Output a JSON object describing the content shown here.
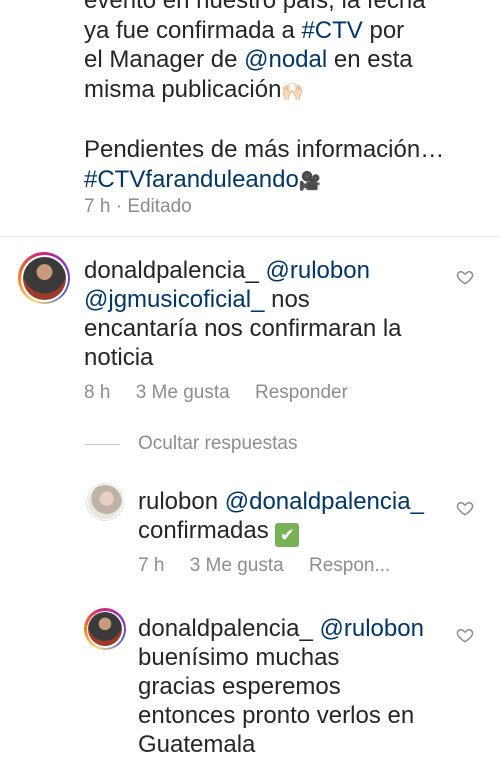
{
  "post_caption": {
    "line0": "evento en nuestro país, la fecha",
    "line1_pre": "ya fue confirmada a ",
    "line1_tag": "#CTV",
    "line1_post": " por",
    "line2_pre": "el Manager de ",
    "line2_tag": "@nodal",
    "line2_post": " en esta",
    "line3": "misma publicación",
    "line3_emoji": "🙌🏻",
    "line4": " Pendientes de más información…",
    "line5_tag": "#CTVfaranduleando",
    "line5_emoji": "🎥",
    "meta_time": "7 h",
    "meta_sep": " · ",
    "meta_edited": "Editado"
  },
  "comments": [
    {
      "username": "donaldpalencia_",
      "mention1": "@rulobon",
      "mention2": "@jgmusicoficial_",
      "text_after": " nos",
      "text_line3": "encantaría nos confirmaran la",
      "text_line4": "noticia",
      "time": "8 h",
      "likes": "3 Me gusta",
      "reply": "Responder",
      "avatar_icon": "profile-photo"
    }
  ],
  "hide_replies_label": "Ocultar respuestas",
  "replies": [
    {
      "username": "rulobon",
      "mention": "@donaldpalencia_",
      "text": "confirmadas",
      "emoji": "✔",
      "time": "7 h",
      "likes": "3 Me gusta",
      "reply": "Respon..."
    },
    {
      "username": "donaldpalencia_",
      "mention": "@rulobon",
      "line2": "buenísimo muchas",
      "line3": "gracias esperemos",
      "line4": "entonces pronto verlos en",
      "line5": "Guatemala"
    }
  ],
  "colors": {
    "link": "#00376b",
    "muted": "#8e8e8e",
    "text": "#262626"
  }
}
